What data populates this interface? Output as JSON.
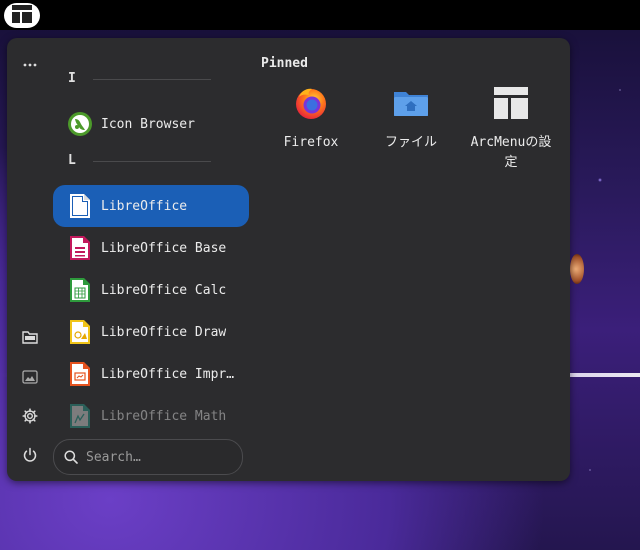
{
  "topbar": {
    "arcmenu_button_icon": "arcmenu-layout-icon"
  },
  "rail": {
    "top_icon": "more-dots-icon",
    "bottom_icons": [
      "file-manager-icon",
      "pictures-icon",
      "settings-gear-icon",
      "power-icon"
    ]
  },
  "list": {
    "sections": [
      {
        "letter": "I",
        "items": [
          {
            "label": "Icon Browser",
            "icon": "icon-browser-icon"
          }
        ]
      },
      {
        "letter": "L",
        "items": [
          {
            "label": "LibreOffice",
            "icon": "libreoffice-icon",
            "selected": true
          },
          {
            "label": "LibreOffice Base",
            "icon": "libreoffice-base-icon"
          },
          {
            "label": "LibreOffice Calc",
            "icon": "libreoffice-calc-icon"
          },
          {
            "label": "LibreOffice Draw",
            "icon": "libreoffice-draw-icon"
          },
          {
            "label": "LibreOffice Impr…",
            "icon": "libreoffice-impress-icon"
          },
          {
            "label": "LibreOffice Math",
            "icon": "libreoffice-math-icon"
          }
        ]
      }
    ]
  },
  "search": {
    "placeholder": "Search…"
  },
  "pinned": {
    "title": "Pinned",
    "items": [
      {
        "label": "Firefox",
        "icon": "firefox-icon"
      },
      {
        "label": "ファイル",
        "icon": "files-folder-icon"
      },
      {
        "label": "ArcMenuの設定",
        "icon": "arcmenu-settings-icon"
      }
    ]
  },
  "colors": {
    "selection": "#1b5fb6",
    "panel": "#2c2c2e"
  }
}
